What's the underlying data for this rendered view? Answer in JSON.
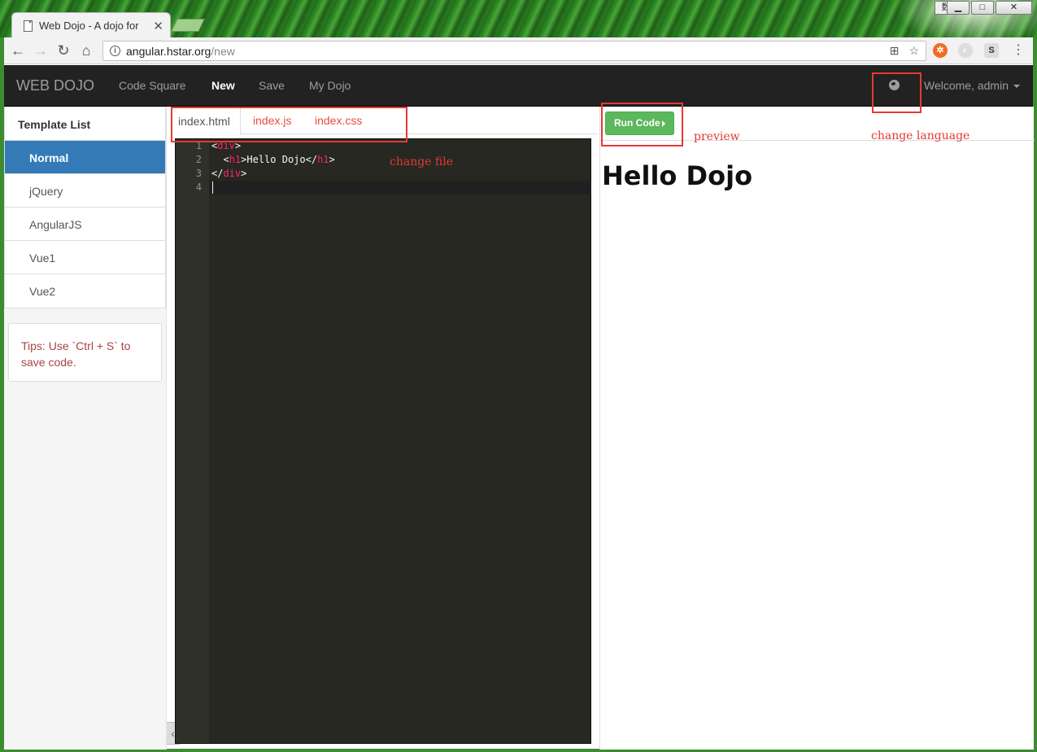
{
  "browser": {
    "tab_title": "Web Dojo - A dojo for",
    "tab_close": "✕",
    "url_host": "angular.hstar.org",
    "url_path": "/new",
    "ime_label": "数",
    "window_buttons": [
      "▁",
      "□",
      "✕"
    ]
  },
  "navbar": {
    "brand": "WEB DOJO",
    "links": [
      "Code Square",
      "New",
      "Save",
      "My Dojo"
    ],
    "active_link": "New",
    "user_menu": "Welcome, admin",
    "language_icon": "globe-icon"
  },
  "sidebar": {
    "heading": "Template List",
    "items": [
      "Normal",
      "jQuery",
      "AngularJS",
      "Vue1",
      "Vue2"
    ],
    "active_item": "Normal",
    "tips": "Tips: Use `Ctrl + S` to save code."
  },
  "editor": {
    "tabs": [
      "index.html",
      "index.js",
      "index.css"
    ],
    "active_tab": "index.html",
    "line_numbers": [
      "1",
      "2",
      "3",
      "4"
    ],
    "lines": [
      {
        "open": "<",
        "tag": "div",
        "close": ">",
        "text": "",
        "end": ""
      },
      {
        "open": "  <",
        "tag": "h1",
        "close": ">",
        "text": "Hello Dojo</",
        "end": "h1"
      },
      {
        "open": "</",
        "tag": "div",
        "close": ">",
        "text": "",
        "end": ""
      }
    ],
    "line2_tail": ">"
  },
  "preview": {
    "run_button": "Run Code",
    "output_heading": "Hello Dojo"
  },
  "annotations": {
    "change_file": "change file",
    "preview": "preview",
    "change_language": "change language"
  },
  "colors": {
    "annotation": "#e53935",
    "active_item": "#337ab7",
    "run_button": "#5cb85c",
    "navbar": "#222222",
    "editor_bg": "#272822",
    "tag": "#f92672"
  }
}
